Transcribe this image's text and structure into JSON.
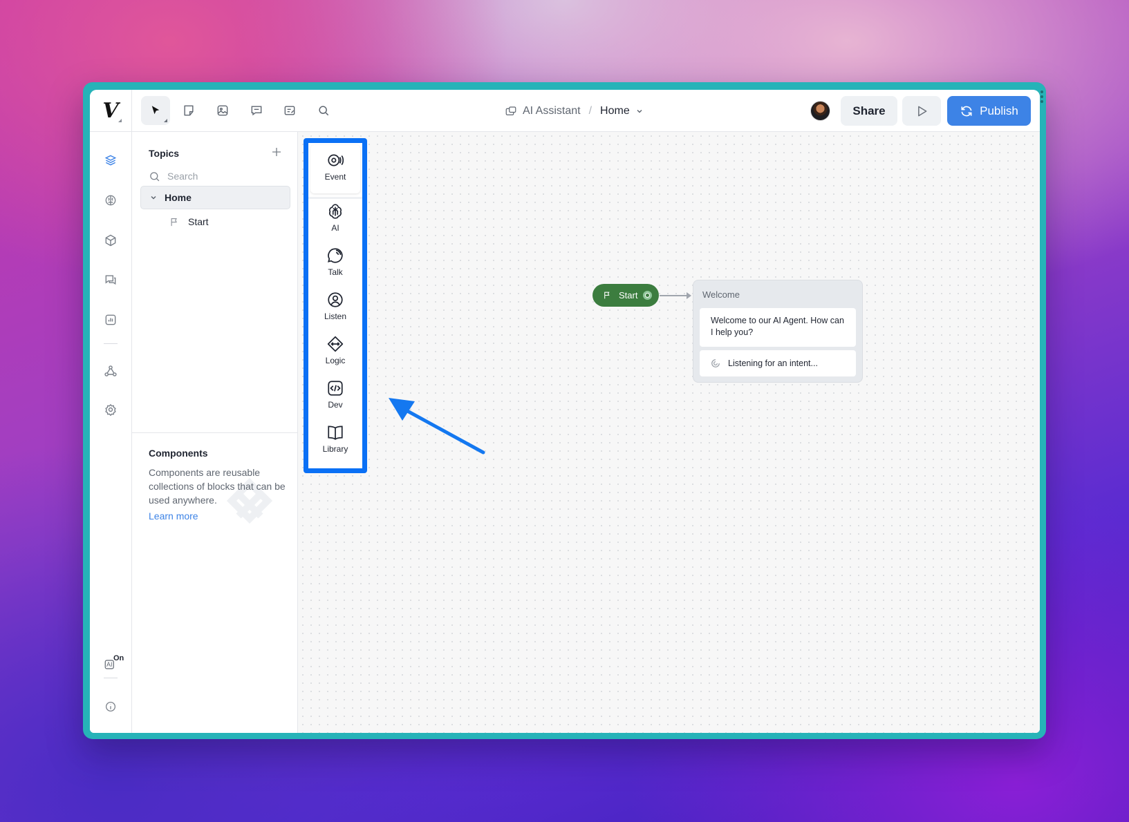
{
  "app": {
    "logo_letter": "V",
    "fab_letter": "V"
  },
  "breadcrumb": {
    "project": "AI Assistant",
    "separator": "/",
    "current": "Home"
  },
  "header": {
    "share_label": "Share",
    "publish_label": "Publish"
  },
  "topics": {
    "title": "Topics",
    "search_placeholder": "Search",
    "items": [
      {
        "label": "Home",
        "expanded": true
      },
      {
        "label": "Start"
      }
    ]
  },
  "components": {
    "title": "Components",
    "description": "Components are reusable collections of blocks that can be used anywhere.",
    "link": "Learn more"
  },
  "rail": {
    "ai_badge_text": "AI",
    "ai_status": "On"
  },
  "blocks": [
    {
      "label": "Event",
      "icon": "event-icon"
    },
    {
      "label": "AI",
      "icon": "ai-icon"
    },
    {
      "label": "Talk",
      "icon": "talk-icon"
    },
    {
      "label": "Listen",
      "icon": "listen-icon"
    },
    {
      "label": "Logic",
      "icon": "logic-icon"
    },
    {
      "label": "Dev",
      "icon": "dev-icon"
    },
    {
      "label": "Library",
      "icon": "library-icon"
    }
  ],
  "canvas": {
    "start_node": "Start",
    "welcome_block": {
      "title": "Welcome",
      "message": "Welcome to our AI Agent. How can I help you?",
      "listening": "Listening for an intent..."
    }
  },
  "colors": {
    "accent": "#3d83e6",
    "highlight_border": "#0a70f5",
    "start_node": "#3c7d3f",
    "frame": "#26b3b8"
  }
}
